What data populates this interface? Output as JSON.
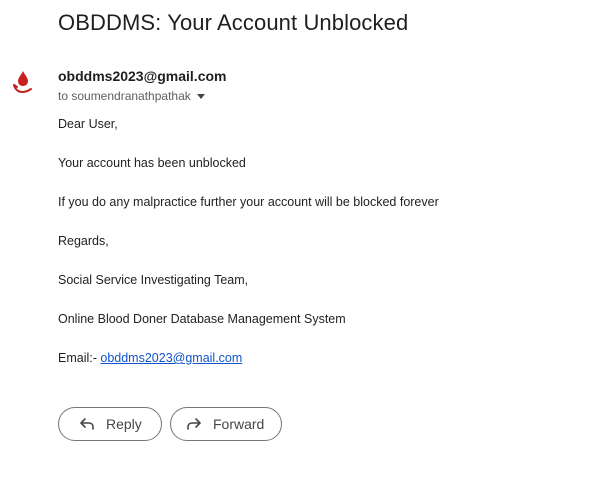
{
  "email": {
    "subject": "OBDDMS: Your Account Unblocked",
    "sender": "obddms2023@gmail.com",
    "recipient": "to soumendranathpathak",
    "body": {
      "greeting": "Dear User,",
      "line1": "Your account has been unblocked",
      "line2": "If you do any malpractice further your account will be blocked forever",
      "regards": "Regards,",
      "team": "Social Service Investigating Team,",
      "system": "Online Blood Doner Database Management System",
      "email_prefix": "Email:- ",
      "email_link": "obddms2023@gmail.com"
    }
  },
  "actions": {
    "reply_label": "Reply",
    "forward_label": "Forward"
  },
  "icons": {
    "avatar": "blood-drop-hand-icon",
    "recipient_caret": "caret-down-icon",
    "reply": "reply-arrow-icon",
    "forward": "forward-arrow-icon"
  },
  "colors": {
    "avatar_red": "#c5221f",
    "link": "#1155cc"
  }
}
